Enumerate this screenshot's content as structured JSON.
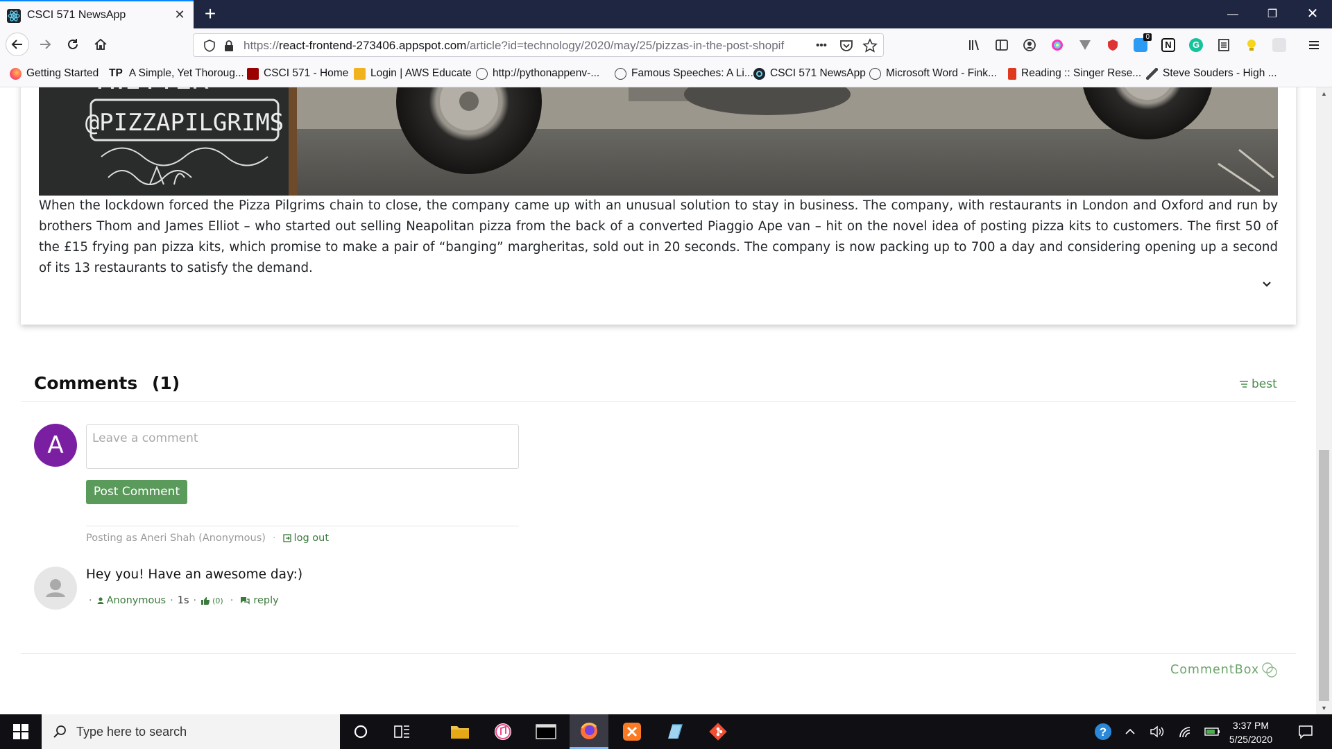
{
  "browser": {
    "tab": {
      "title": "CSCI 571 NewsApp",
      "favicon": "react-icon"
    },
    "url": {
      "scheme": "https://",
      "host": "react-frontend-273406.appspot.com",
      "path": "/article?id=technology/2020/may/25/pizzas-in-the-post-shopif",
      "more_label": "•••"
    },
    "extension_badge": "0",
    "bookmarks": [
      {
        "label": "Getting Started",
        "icon": "firefox-icon"
      },
      {
        "label": "A Simple, Yet Thoroug...",
        "icon": "tp-icon",
        "prefix": "TP"
      },
      {
        "label": "CSCI 571 - Home",
        "icon": "usc-icon"
      },
      {
        "label": "Login | AWS Educate",
        "icon": "aws-icon"
      },
      {
        "label": "http://pythonappenv-...",
        "icon": "globe-icon"
      },
      {
        "label": "Famous Speeches: A Li...",
        "icon": "globe-icon"
      },
      {
        "label": "CSCI 571 NewsApp",
        "icon": "react-icon"
      },
      {
        "label": "Microsoft Word - Fink...",
        "icon": "globe-icon"
      },
      {
        "label": "Reading :: Singer Rese...",
        "icon": "reading-icon"
      },
      {
        "label": "Steve Souders - High ...",
        "icon": "dog-icon"
      }
    ]
  },
  "article": {
    "image_sign_text": "@PIZZAPILGRIMS",
    "image_sign_top": "TWITTER",
    "body": "When the lockdown forced the Pizza Pilgrims chain to close, the company came up with an unusual solution to stay in business. The company, with restaurants in London and Oxford and run by brothers Thom and James Elliot – who started out selling Neapolitan pizza from the back of a converted Piaggio Ape van – hit on the novel idea of posting pizza kits to customers. The first 50 of the £15 frying pan pizza kits, which promise to make a pair of “banging” margheritas, sold out in 20 seconds. The company is now packing up to 700 a day and considering opening up a second of its 13 restaurants to satisfy the demand."
  },
  "comments": {
    "title": "Comments",
    "count": "(1)",
    "sort_label": "best",
    "user_initial": "A",
    "input_placeholder": "Leave a comment",
    "post_button": "Post Comment",
    "posting_as": "Posting as Aneri Shah (Anonymous)",
    "separator": "·",
    "logout": "log out",
    "items": [
      {
        "text": "Hey you! Have an awesome day:)",
        "author": "Anonymous",
        "time": "1s",
        "likes": "(0)",
        "reply": "reply"
      }
    ],
    "brand": "CommentBox"
  },
  "taskbar": {
    "search_placeholder": "Type here to search",
    "time": "3:37 PM",
    "date": "5/25/2020"
  },
  "colors": {
    "accent_green": "#5a9a5a",
    "link_green": "#3b7a3b",
    "avatar_purple": "#7b1fa2",
    "titlebar": "#1f2642"
  }
}
